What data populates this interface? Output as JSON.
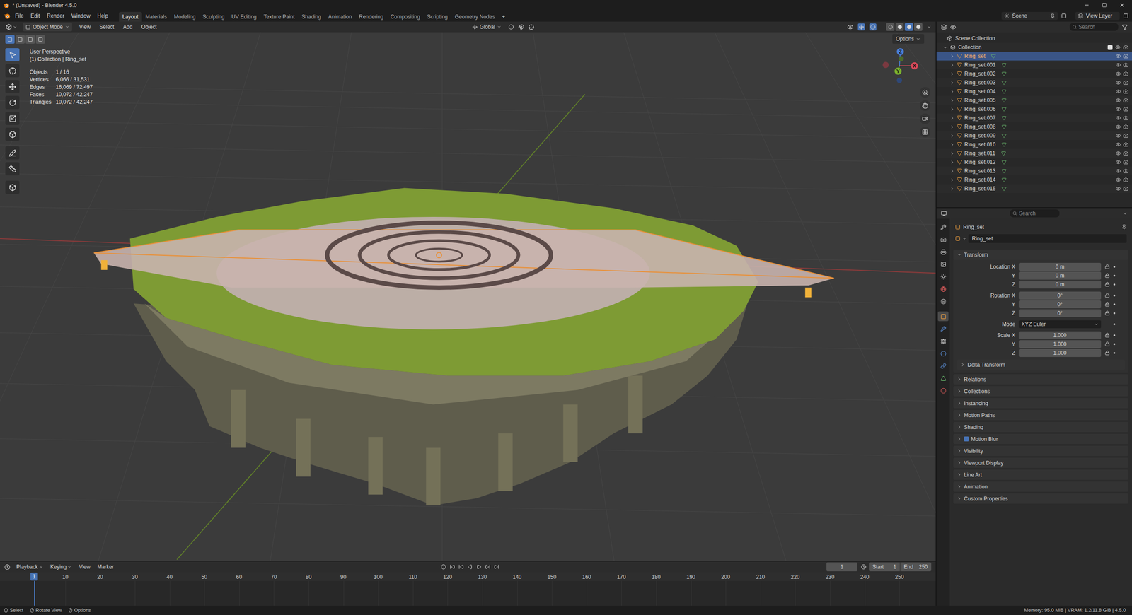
{
  "window": {
    "title": "* (Unsaved) - Blender 4.5.0"
  },
  "menus": [
    "File",
    "Edit",
    "Render",
    "Window",
    "Help"
  ],
  "workspaces": [
    {
      "label": "Layout",
      "selected": true
    },
    {
      "label": "Materials",
      "selected": false
    },
    {
      "label": "Modeling",
      "selected": false
    },
    {
      "label": "Sculpting",
      "selected": false
    },
    {
      "label": "UV Editing",
      "selected": false
    },
    {
      "label": "Texture Paint",
      "selected": false
    },
    {
      "label": "Shading",
      "selected": false
    },
    {
      "label": "Animation",
      "selected": false
    },
    {
      "label": "Rendering",
      "selected": false
    },
    {
      "label": "Compositing",
      "selected": false
    },
    {
      "label": "Scripting",
      "selected": false
    },
    {
      "label": "Geometry Nodes",
      "selected": false
    }
  ],
  "add_workspace": "+",
  "scene": "Scene",
  "view_layer": "View Layer",
  "viewport": {
    "header": {
      "mode": "Object Mode",
      "menus": [
        "View",
        "Select",
        "Add",
        "Object"
      ],
      "orientation": "Global",
      "options": "Options"
    },
    "select_modes": [
      {
        "selected": true
      },
      {
        "selected": false
      },
      {
        "selected": false
      },
      {
        "selected": false
      }
    ],
    "tools": [
      {
        "selected": true
      },
      {
        "selected": false
      },
      {
        "selected": false
      },
      {
        "selected": false
      },
      {
        "selected": false
      },
      {
        "selected": false
      },
      {
        "selected": false
      },
      {
        "selected": false
      },
      {
        "selected": false
      }
    ],
    "shading_modes": [
      {
        "selected": false
      },
      {
        "selected": false
      },
      {
        "selected": true
      },
      {
        "selected": false
      }
    ],
    "overlay": {
      "view": "User Perspective",
      "context": "(1) Collection | Ring_set",
      "stats": [
        {
          "label": "Objects",
          "value": "1 / 16"
        },
        {
          "label": "Vertices",
          "value": "6,066 / 31,531"
        },
        {
          "label": "Edges",
          "value": "16,069 / 72,497"
        },
        {
          "label": "Faces",
          "value": "10,072 / 42,247"
        },
        {
          "label": "Triangles",
          "value": "10,072 / 42,247"
        }
      ]
    },
    "gizmo_axes": [
      "X",
      "Y",
      "Z"
    ]
  },
  "outliner": {
    "search_placeholder": "Search",
    "scene_collection": "Scene Collection",
    "collection": "Collection",
    "items": [
      {
        "name": "Ring_set",
        "selected": true
      },
      {
        "name": "Ring_set.001",
        "selected": false
      },
      {
        "name": "Ring_set.002",
        "selected": false
      },
      {
        "name": "Ring_set.003",
        "selected": false
      },
      {
        "name": "Ring_set.004",
        "selected": false
      },
      {
        "name": "Ring_set.005",
        "selected": false
      },
      {
        "name": "Ring_set.006",
        "selected": false
      },
      {
        "name": "Ring_set.007",
        "selected": false
      },
      {
        "name": "Ring_set.008",
        "selected": false
      },
      {
        "name": "Ring_set.009",
        "selected": false
      },
      {
        "name": "Ring_set.010",
        "selected": false
      },
      {
        "name": "Ring_set.011",
        "selected": false
      },
      {
        "name": "Ring_set.012",
        "selected": false
      },
      {
        "name": "Ring_set.013",
        "selected": false
      },
      {
        "name": "Ring_set.014",
        "selected": false
      },
      {
        "name": "Ring_set.015",
        "selected": false
      }
    ]
  },
  "properties": {
    "search_placeholder": "Search",
    "object": "Ring_set",
    "datablock": "Ring_set",
    "tabs": [
      {
        "selected": false
      },
      {
        "selected": false
      },
      {
        "selected": false
      },
      {
        "selected": false
      },
      {
        "selected": false
      },
      {
        "selected": false
      },
      {
        "selected": false
      },
      {
        "selected": true
      },
      {
        "selected": false
      },
      {
        "selected": false
      },
      {
        "selected": false
      },
      {
        "selected": false
      },
      {
        "selected": false
      },
      {
        "selected": false
      }
    ],
    "transform": {
      "title": "Transform",
      "expanded": true,
      "groups": [
        [
          {
            "kind": "field",
            "label": "Location X",
            "value": "0 m"
          },
          {
            "kind": "field",
            "label": "Y",
            "value": "0 m"
          },
          {
            "kind": "field",
            "label": "Z",
            "value": "0 m"
          }
        ],
        [
          {
            "kind": "field",
            "label": "Rotation X",
            "value": "0°"
          },
          {
            "kind": "field",
            "label": "Y",
            "value": "0°"
          },
          {
            "kind": "field",
            "label": "Z",
            "value": "0°"
          }
        ],
        [
          {
            "kind": "dropdown",
            "label": "Mode",
            "value": "XYZ Euler"
          }
        ],
        [
          {
            "kind": "field",
            "label": "Scale X",
            "value": "1.000"
          },
          {
            "kind": "field",
            "label": "Y",
            "value": "1.000"
          },
          {
            "kind": "field",
            "label": "Z",
            "value": "1.000"
          }
        ]
      ]
    },
    "delta": {
      "title": "Delta Transform",
      "expanded": false
    },
    "panels": [
      {
        "kind": "panel",
        "title": "Relations",
        "expanded": false
      },
      {
        "kind": "panel",
        "title": "Collections",
        "expanded": false
      },
      {
        "kind": "panel",
        "title": "Instancing",
        "expanded": false
      },
      {
        "kind": "panel",
        "title": "Motion Paths",
        "expanded": false
      },
      {
        "kind": "panel",
        "title": "Shading",
        "expanded": false
      },
      {
        "kind": "checkbox",
        "title": "Motion Blur",
        "expanded": false,
        "checked": true
      },
      {
        "kind": "panel",
        "title": "Visibility",
        "expanded": false
      },
      {
        "kind": "panel",
        "title": "Viewport Display",
        "expanded": false
      },
      {
        "kind": "panel",
        "title": "Line Art",
        "expanded": false
      },
      {
        "kind": "panel",
        "title": "Animation",
        "expanded": false
      },
      {
        "kind": "panel",
        "title": "Custom Properties",
        "expanded": false
      }
    ]
  },
  "timeline": {
    "menus": [
      {
        "label": "Playback",
        "dropdown": true
      },
      {
        "label": "Keying",
        "dropdown": true
      },
      {
        "label": "View",
        "dropdown": false
      },
      {
        "label": "Marker",
        "dropdown": false
      }
    ],
    "current_frame": "1",
    "start_label": "Start",
    "start": "1",
    "end_label": "End",
    "end": "250",
    "marker": "1",
    "ticks": [
      "10",
      "20",
      "30",
      "40",
      "50",
      "60",
      "70",
      "80",
      "90",
      "100",
      "110",
      "120",
      "130",
      "140",
      "150",
      "160",
      "170",
      "180",
      "190",
      "200",
      "210",
      "220",
      "230",
      "240",
      "250"
    ]
  },
  "status_bar": {
    "items": [
      "Select",
      "Rotate View",
      "Options"
    ],
    "info": "Memory: 95.0 MiB | VRAM: 1.2/11.8 GiB | 4.5.0"
  }
}
